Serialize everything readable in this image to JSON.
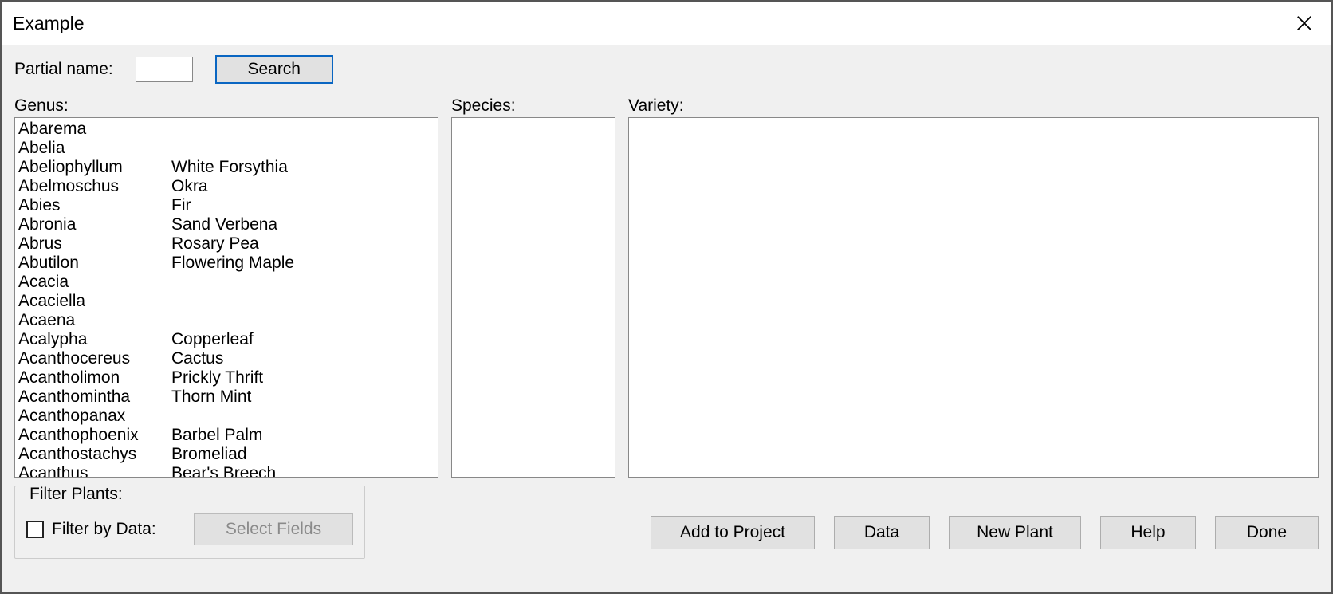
{
  "header": {
    "title": "Example"
  },
  "search": {
    "label": "Partial name:",
    "value": "",
    "button": "Search"
  },
  "labels": {
    "genus": "Genus:",
    "species": "Species:",
    "variety": "Variety:"
  },
  "genus_items": [
    {
      "name": "Abarema",
      "common": ""
    },
    {
      "name": "Abelia",
      "common": ""
    },
    {
      "name": "Abeliophyllum",
      "common": "White Forsythia"
    },
    {
      "name": "Abelmoschus",
      "common": "Okra"
    },
    {
      "name": "Abies",
      "common": "Fir"
    },
    {
      "name": "Abronia",
      "common": "Sand Verbena"
    },
    {
      "name": "Abrus",
      "common": "Rosary Pea"
    },
    {
      "name": "Abutilon",
      "common": "Flowering Maple"
    },
    {
      "name": "Acacia",
      "common": ""
    },
    {
      "name": "Acaciella",
      "common": ""
    },
    {
      "name": "Acaena",
      "common": ""
    },
    {
      "name": "Acalypha",
      "common": "Copperleaf"
    },
    {
      "name": "Acanthocereus",
      "common": "Cactus"
    },
    {
      "name": "Acantholimon",
      "common": "Prickly Thrift"
    },
    {
      "name": "Acanthomintha",
      "common": "Thorn Mint"
    },
    {
      "name": "Acanthopanax",
      "common": ""
    },
    {
      "name": "Acanthophoenix",
      "common": "Barbel Palm"
    },
    {
      "name": "Acanthostachys",
      "common": "Bromeliad"
    },
    {
      "name": "Acanthus",
      "common": "Bear's Breech"
    }
  ],
  "filter": {
    "legend": "Filter Plants:",
    "checkbox_label": "Filter by Data:",
    "select_fields": "Select Fields"
  },
  "buttons": {
    "add_to_project": "Add to Project",
    "data": "Data",
    "new_plant": "New Plant",
    "help": "Help",
    "done": "Done"
  }
}
